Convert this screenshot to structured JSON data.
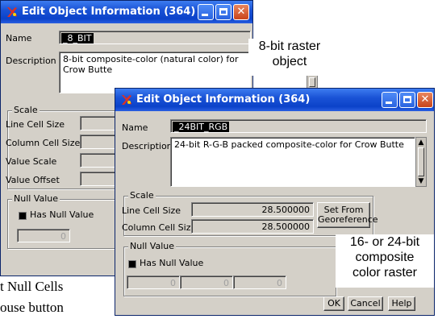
{
  "background_text": {
    "line1": "t Null Cells",
    "line2": "ouse button"
  },
  "window_back": {
    "title": "Edit Object Information (364)",
    "name_label": "Name",
    "name_value": "_8_BIT",
    "description_label": "Description",
    "description_value": "8-bit composite-color (natural color) for Crow Butte",
    "scale_group": "Scale",
    "line_cell_size_label": "Line Cell Size",
    "column_cell_size_label": "Column Cell Size",
    "value_scale_label": "Value Scale",
    "value_offset_label": "Value Offset",
    "null_group": "Null Value",
    "has_null_label": "Has Null Value",
    "null_value": "0"
  },
  "window_front": {
    "title": "Edit Object Information (364)",
    "name_label": "Name",
    "name_value": "_24BIT_RGB",
    "description_label": "Description",
    "description_value": "24-bit R-G-B packed composite-color for Crow Butte",
    "scale_group": "Scale",
    "line_cell_size_label": "Line Cell Size",
    "line_cell_size_value": "28.500000",
    "column_cell_size_label": "Column Cell Size",
    "column_cell_size_value": "28.500000",
    "set_from_georeference": "Set From Georeference",
    "set_from_line1": "Set From",
    "set_from_line2": "Georeference",
    "null_group": "Null Value",
    "has_null_label": "Has Null Value",
    "null_values": [
      "0",
      "0",
      "0"
    ],
    "ok_label": "OK",
    "cancel_label": "Cancel",
    "help_label": "Help"
  },
  "callouts": {
    "eight_bit_line1": "8-bit raster",
    "eight_bit_line2": "object",
    "composite_line1": "16- or 24-bit",
    "composite_line2": "composite",
    "composite_line3": "color raster"
  },
  "colors": {
    "titlebar": "#0b42c9",
    "dialog_face": "#d4d0c8",
    "close_button": "#c9441a"
  }
}
